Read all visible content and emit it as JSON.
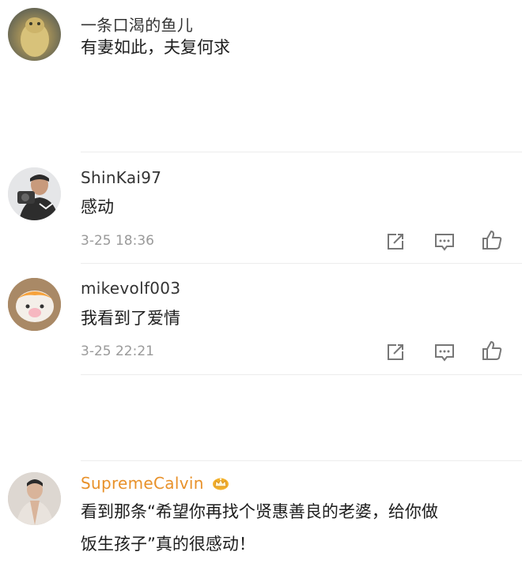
{
  "comments": [
    {
      "username": "一条口渴的鱼儿",
      "text": "有妻如此，夫复何求",
      "avatar": "gecko-avatar"
    },
    {
      "username": "ShinKai97",
      "text": "感动",
      "time": "3-25 18:36",
      "avatar": "person-camera-avatar"
    },
    {
      "username": "mikevolf003",
      "text": "我看到了爱情",
      "time": "3-25 22:21",
      "avatar": "cartoon-avatar"
    },
    {
      "username": "SupremeCalvin",
      "text_line1": "看到那条“希望你再找个贤惠善良的老婆，给你做",
      "text_line2": "饭生孩子”真的很感动！",
      "avatar": "person-avatar",
      "username_color": "#e8912a",
      "badge": "crown-icon"
    }
  ],
  "colors": {
    "username": "#333333",
    "meta": "#9a9a9a",
    "divider": "#ececec",
    "vip": "#e8912a"
  }
}
